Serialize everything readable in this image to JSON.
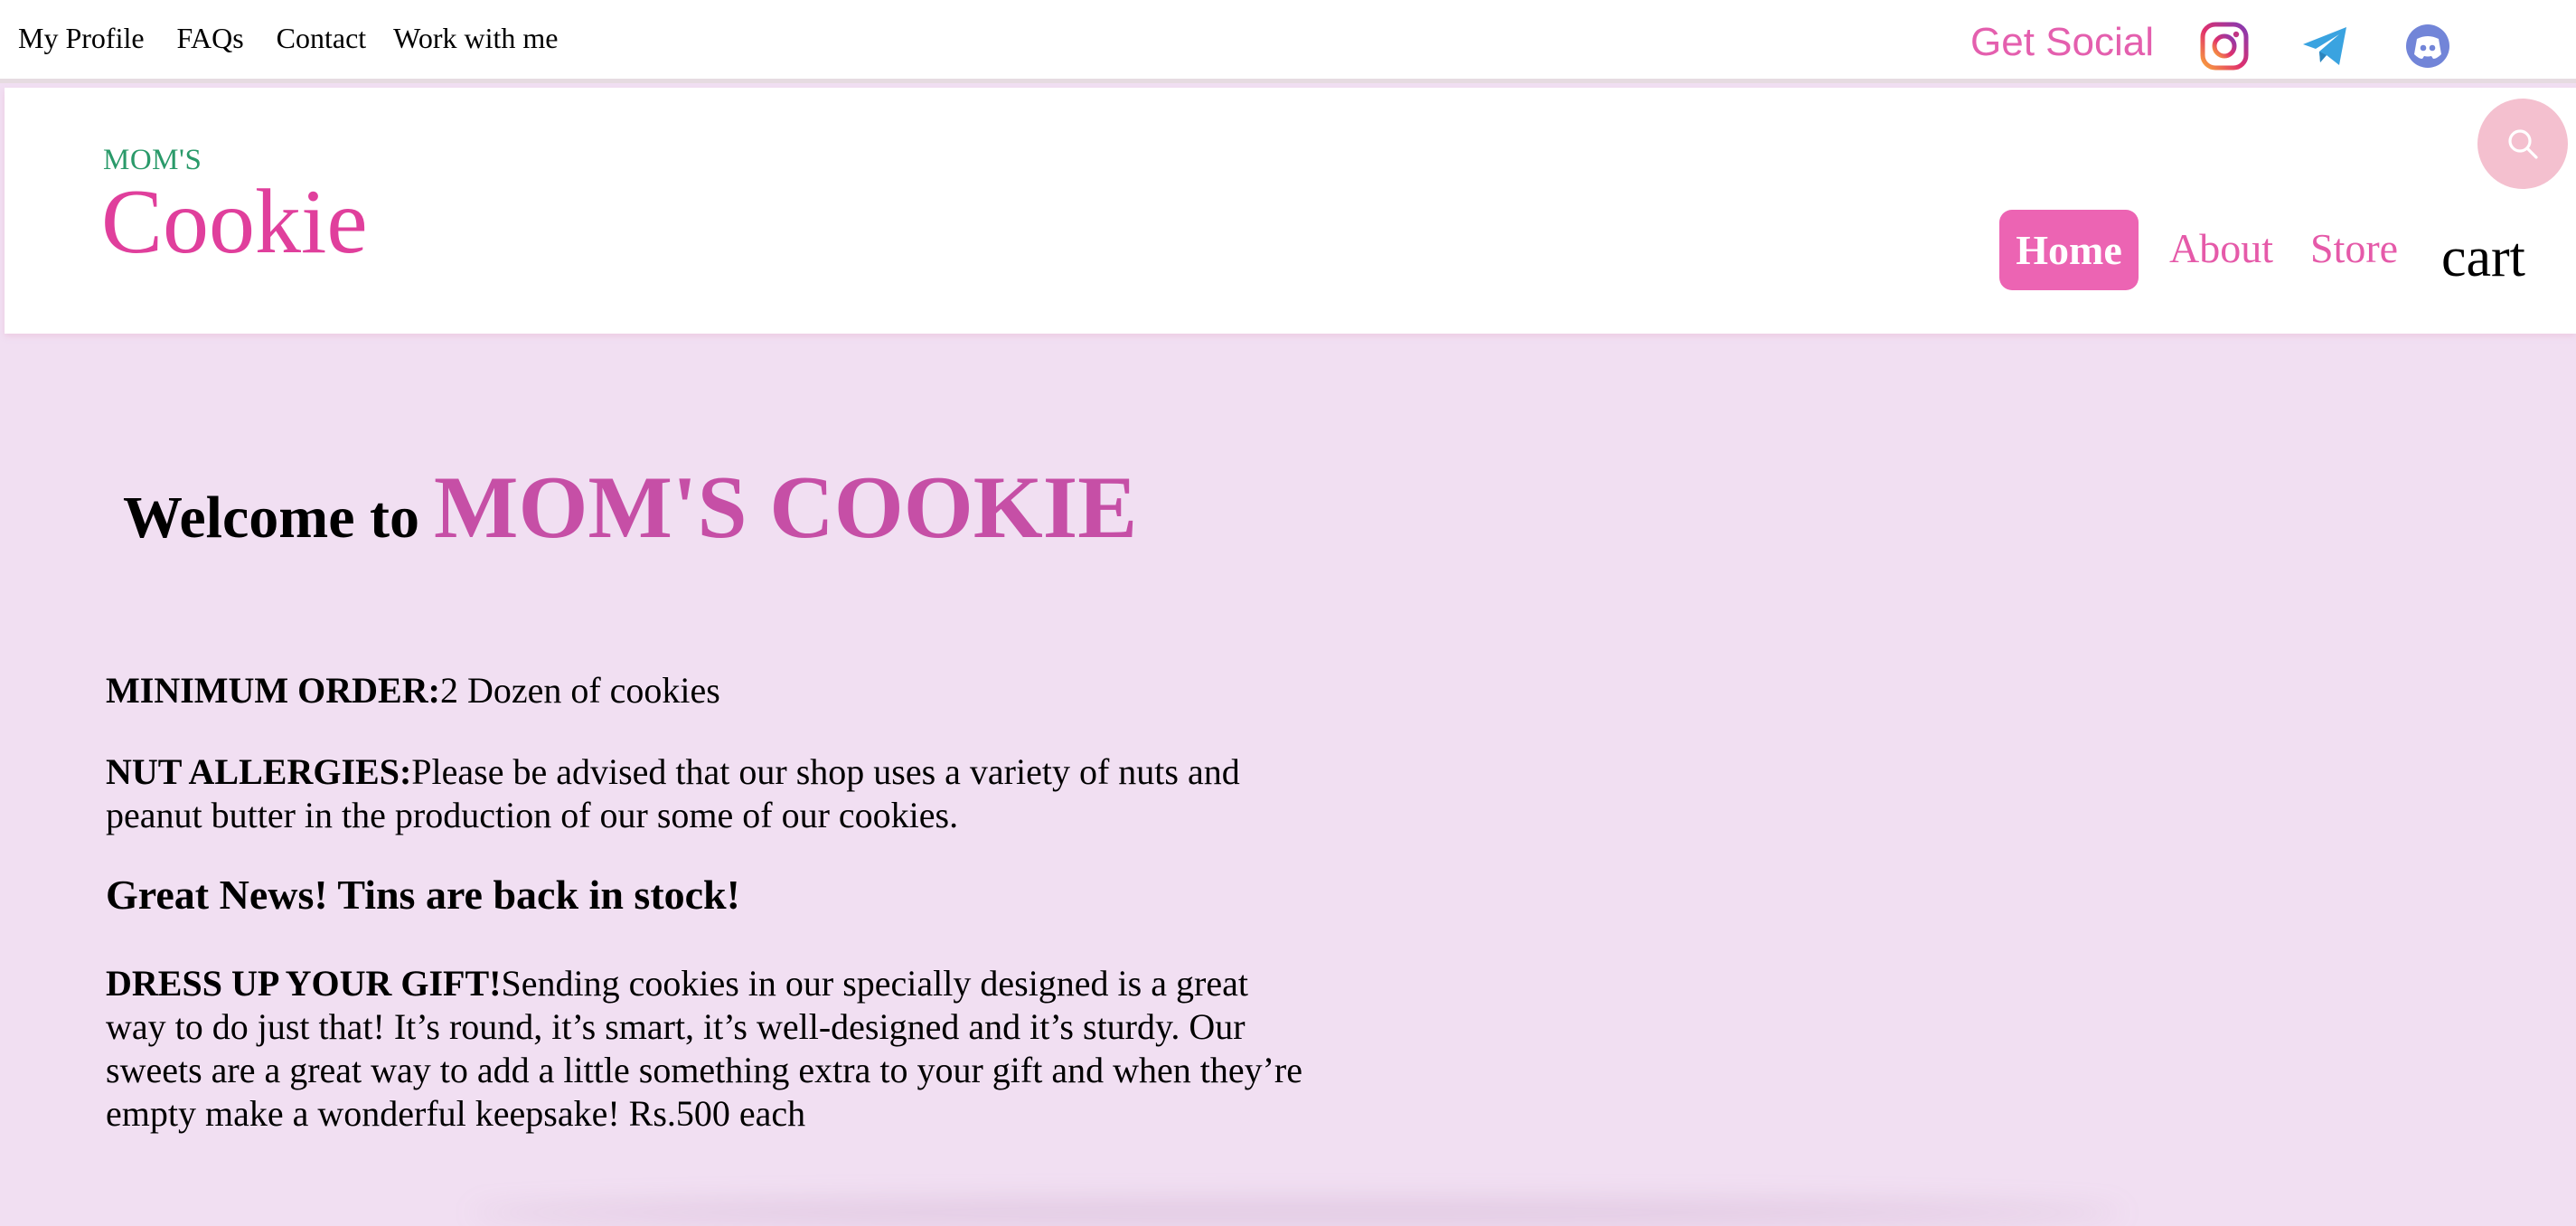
{
  "topbar": {
    "links": [
      "My Profile",
      "FAQs",
      "Contact",
      "Work with me"
    ],
    "social_label": "Get Social",
    "social_icons": [
      "instagram-icon",
      "telegram-icon",
      "discord-icon"
    ]
  },
  "header": {
    "brand_small": "MOM'S",
    "brand_big": "Cookie",
    "search_icon": "search-icon",
    "nav": {
      "home": "Home",
      "about": "About",
      "store": "Store",
      "cart": "cart"
    }
  },
  "main": {
    "welcome_prefix": "Welcome to",
    "welcome_brand": "MOM'S COOKIE",
    "min_order_label": "MINIMUM ORDER:",
    "min_order_text": "2 Dozen of cookies",
    "nut_label": "NUT ALLERGIES:",
    "nut_text": "Please be advised that our shop uses a variety of nuts and peanut butter in the production of our some of our cookies.",
    "news": "Great News! Tins are back in stock!",
    "gift_label": "DRESS UP YOUR GIFT!",
    "gift_text": "Sending cookies in our specially designed is a great way to do just that! It’s round, it’s smart, it’s well-designed and it’s sturdy. Our sweets are a great way to add a little something extra to your gift and when they’re empty make a wonderful keepsake! Rs.500 each"
  },
  "colors": {
    "page_bg": "#f1dff2",
    "accent_pink": "#e03f9c",
    "nav_pink": "#ec64b3",
    "welcome_brand": "#c64fa6",
    "brand_small": "#2a9a6a",
    "search_bg": "#f4c0cf"
  }
}
